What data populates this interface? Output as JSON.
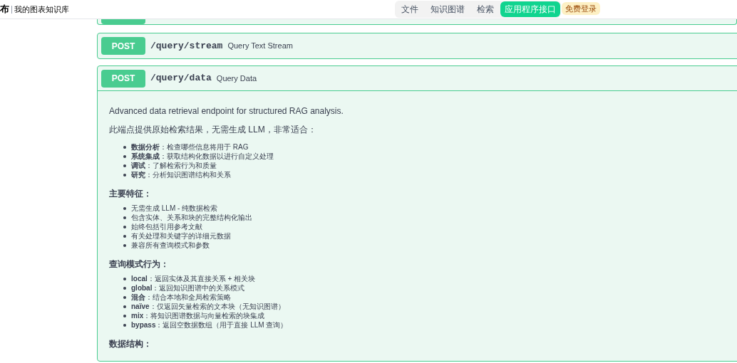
{
  "header": {
    "logo": "布",
    "subtitle": "我的图表知识库",
    "tabs": [
      {
        "label": "文件",
        "selected": false
      },
      {
        "label": "知识图谱",
        "selected": false
      },
      {
        "label": "检索",
        "selected": false
      },
      {
        "label": "应用程序接口",
        "selected": true
      }
    ],
    "login": "免费登录"
  },
  "operations": [
    {
      "kind": "cut"
    },
    {
      "method": "POST",
      "path": "/query/stream",
      "summary": "Query Text Stream",
      "expanded": false
    },
    {
      "method": "POST",
      "path": "/query/data",
      "summary": "Query Data",
      "expanded": true,
      "description": [
        {
          "kind": "para",
          "text": "Advanced data retrieval endpoint for structured RAG analysis."
        },
        {
          "kind": "para",
          "text": "此端点提供原始检索结果，无需生成 LLM，非常适合："
        },
        {
          "kind": "list",
          "items": [
            "**数据分析**：检查哪些信息将用于 RAG",
            "**系统集成**：获取结构化数据以进行自定义处理",
            "**调试**：了解检索行为和质量",
            "**研究**：分析知识图谱结构和关系"
          ]
        },
        {
          "kind": "heading",
          "text": "主要特征："
        },
        {
          "kind": "list",
          "items": [
            "无需生成 LLM - 纯数据检索",
            "包含实体、关系和块的完整结构化输出",
            "始终包括引用参考文献",
            "有关处理和关键字的详细元数据",
            "兼容所有查询模式和参数"
          ]
        },
        {
          "kind": "heading",
          "text": "查询模式行为："
        },
        {
          "kind": "list",
          "items": [
            "**local**：返回实体及其直接关系 + 相关块",
            "**global**：返回知识图谱中的关系模式",
            "**混合**：结合本地和全局检索策略",
            "**naïve**：仅返回矢量检索的文本块（无知识图谱）",
            "**mix**：将知识图谱数据与向量检索的块集成",
            "**bypass**：返回空数据数组（用于直接 LLM 查询）"
          ]
        },
        {
          "kind": "heading",
          "text": "数据结构："
        }
      ]
    }
  ]
}
